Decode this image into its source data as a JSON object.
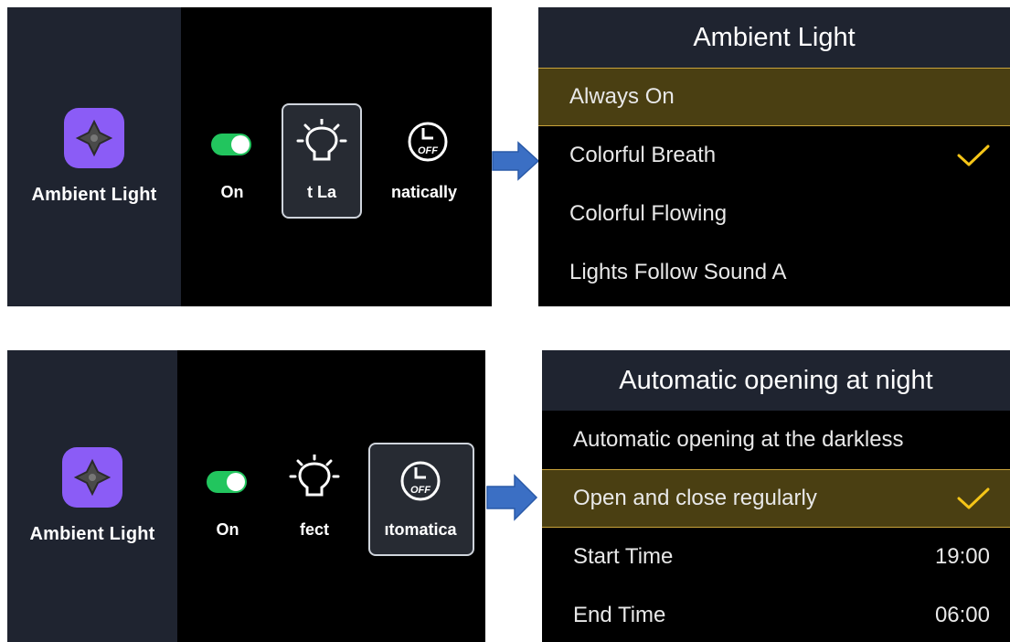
{
  "top": {
    "left": {
      "app_title": "Ambient Light",
      "toggle_label": "On",
      "effect_label": "t La",
      "auto_label": "natically",
      "off_text": "OFF"
    },
    "menu": {
      "title": "Ambient Light",
      "items": [
        {
          "label": "Always On"
        },
        {
          "label": "Colorful Breath"
        },
        {
          "label": "Colorful Flowing"
        },
        {
          "label": "Lights Follow Sound A"
        }
      ]
    }
  },
  "bottom": {
    "left": {
      "app_title": "Ambient Light",
      "toggle_label": "On",
      "effect_label": "fect",
      "auto_label": "ıtomatica",
      "off_text": "OFF"
    },
    "menu": {
      "title": "Automatic opening at night",
      "items": [
        {
          "label": "Automatic opening at the darkless"
        },
        {
          "label": "Open and close regularly"
        },
        {
          "label": "Start Time",
          "value": "19:00"
        },
        {
          "label": "End Time",
          "value": "06:00"
        }
      ]
    }
  },
  "colors": {
    "accent_check": "#f5c518",
    "toggle_on": "#22c55e",
    "arrow": "#3b6fc4",
    "highlight_bg": "#4a3f12",
    "sidebar_bg": "#1f2430"
  }
}
